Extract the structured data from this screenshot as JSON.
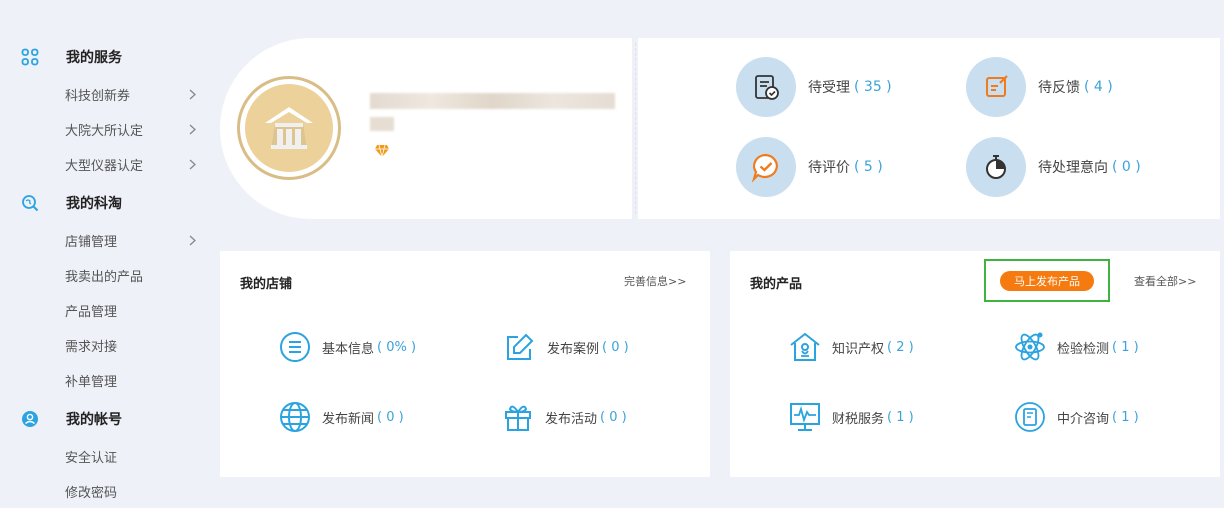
{
  "sidebar": {
    "sections": [
      {
        "title": "我的服务",
        "icon": "grid-icon",
        "items": [
          {
            "label": "科技创新券",
            "chevron": true
          },
          {
            "label": "大院大所认定",
            "chevron": true
          },
          {
            "label": "大型仪器认定",
            "chevron": true
          }
        ]
      },
      {
        "title": "我的科淘",
        "icon": "search-globe-icon",
        "items": [
          {
            "label": "店铺管理",
            "chevron": true
          },
          {
            "label": "我卖出的产品"
          },
          {
            "label": "产品管理"
          },
          {
            "label": "需求对接"
          },
          {
            "label": "补单管理"
          }
        ]
      },
      {
        "title": "我的帐号",
        "icon": "user-icon",
        "items": [
          {
            "label": "安全认证"
          },
          {
            "label": "修改密码"
          }
        ]
      }
    ]
  },
  "status": {
    "items": [
      {
        "label": "待受理",
        "count": "( 35 )",
        "icon": "document-check-icon"
      },
      {
        "label": "待反馈",
        "count": "( 4 )",
        "icon": "edit-note-icon"
      },
      {
        "label": "待评价",
        "count": "( 5 )",
        "icon": "chat-check-icon"
      },
      {
        "label": "待处理意向",
        "count": "( 0 )",
        "icon": "stopwatch-icon"
      }
    ]
  },
  "shop": {
    "title": "我的店铺",
    "link": "完善信息>>",
    "items": [
      {
        "label": "基本信息",
        "count": "( 0% )",
        "icon": "list-circle-icon"
      },
      {
        "label": "发布案例",
        "count": "( 0 )",
        "icon": "edit-icon"
      },
      {
        "label": "发布新闻",
        "count": "( 0 )",
        "icon": "globe-icon"
      },
      {
        "label": "发布活动",
        "count": "( 0 )",
        "icon": "gift-icon"
      }
    ]
  },
  "products": {
    "title": "我的产品",
    "publish_button": "马上发布产品",
    "link": "查看全部>>",
    "items": [
      {
        "label": "知识产权",
        "count": "( 2 )",
        "icon": "house-ip-icon"
      },
      {
        "label": "检验检测",
        "count": "( 1 )",
        "icon": "atom-icon"
      },
      {
        "label": "财税服务",
        "count": "( 1 )",
        "icon": "monitor-chart-icon"
      },
      {
        "label": "中介咨询",
        "count": "( 1 )",
        "icon": "consult-doc-icon"
      }
    ]
  },
  "colors": {
    "accent": "#3ba2da",
    "publish": "#f57a0f",
    "highlight_frame": "#3fb23f",
    "badge_circle": "#c9dff0",
    "avatar_gold": "#d9bd86"
  }
}
